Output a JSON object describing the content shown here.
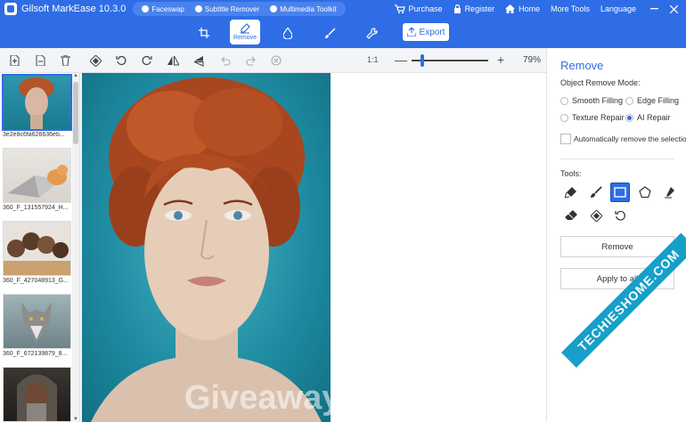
{
  "app": {
    "title": "Gilsoft MarkEase 10.3.0"
  },
  "title_pills": [
    {
      "label": "Faceswap"
    },
    {
      "label": "Subtitle Remover"
    },
    {
      "label": "Multimedia Toolkit"
    }
  ],
  "title_nav": {
    "purchase": "Purchase",
    "register": "Register",
    "home": "Home",
    "more_tools": "More Tools",
    "language": "Language"
  },
  "modules": {
    "active_label": "Remove",
    "export_label": "Export"
  },
  "zoom": {
    "one_to_one": "1:1",
    "minus": "—",
    "plus": "+",
    "percent": "79%",
    "level": 0.79
  },
  "thumbnails": [
    {
      "caption": "3e2e8c6fa626636eb...",
      "selected": true
    },
    {
      "caption": "360_F_131557924_H...",
      "selected": false
    },
    {
      "caption": "360_F_427048913_G...",
      "selected": false
    },
    {
      "caption": "360_F_672139879_8...",
      "selected": false
    },
    {
      "caption": "",
      "selected": false
    }
  ],
  "canvas": {
    "watermark": "Giveaway"
  },
  "panel": {
    "title": "Remove",
    "mode_label": "Object Remove Mode:",
    "modes": {
      "smooth": "Smooth Filling",
      "edge": "Edge Filling",
      "texture": "Texture Repair",
      "ai": "AI Repair"
    },
    "selected_mode": "AI Repair",
    "auto_remove_label": "Automatically remove the selection",
    "tools_label": "Tools:",
    "selected_tool": "rectangle",
    "remove_button": "Remove",
    "apply_button": "Apply to all"
  },
  "overlay": {
    "site_ribbon": "TECHIESHOME.COM"
  },
  "colors": {
    "accent": "#2f6de6",
    "ribbon": "#16a0c9"
  }
}
